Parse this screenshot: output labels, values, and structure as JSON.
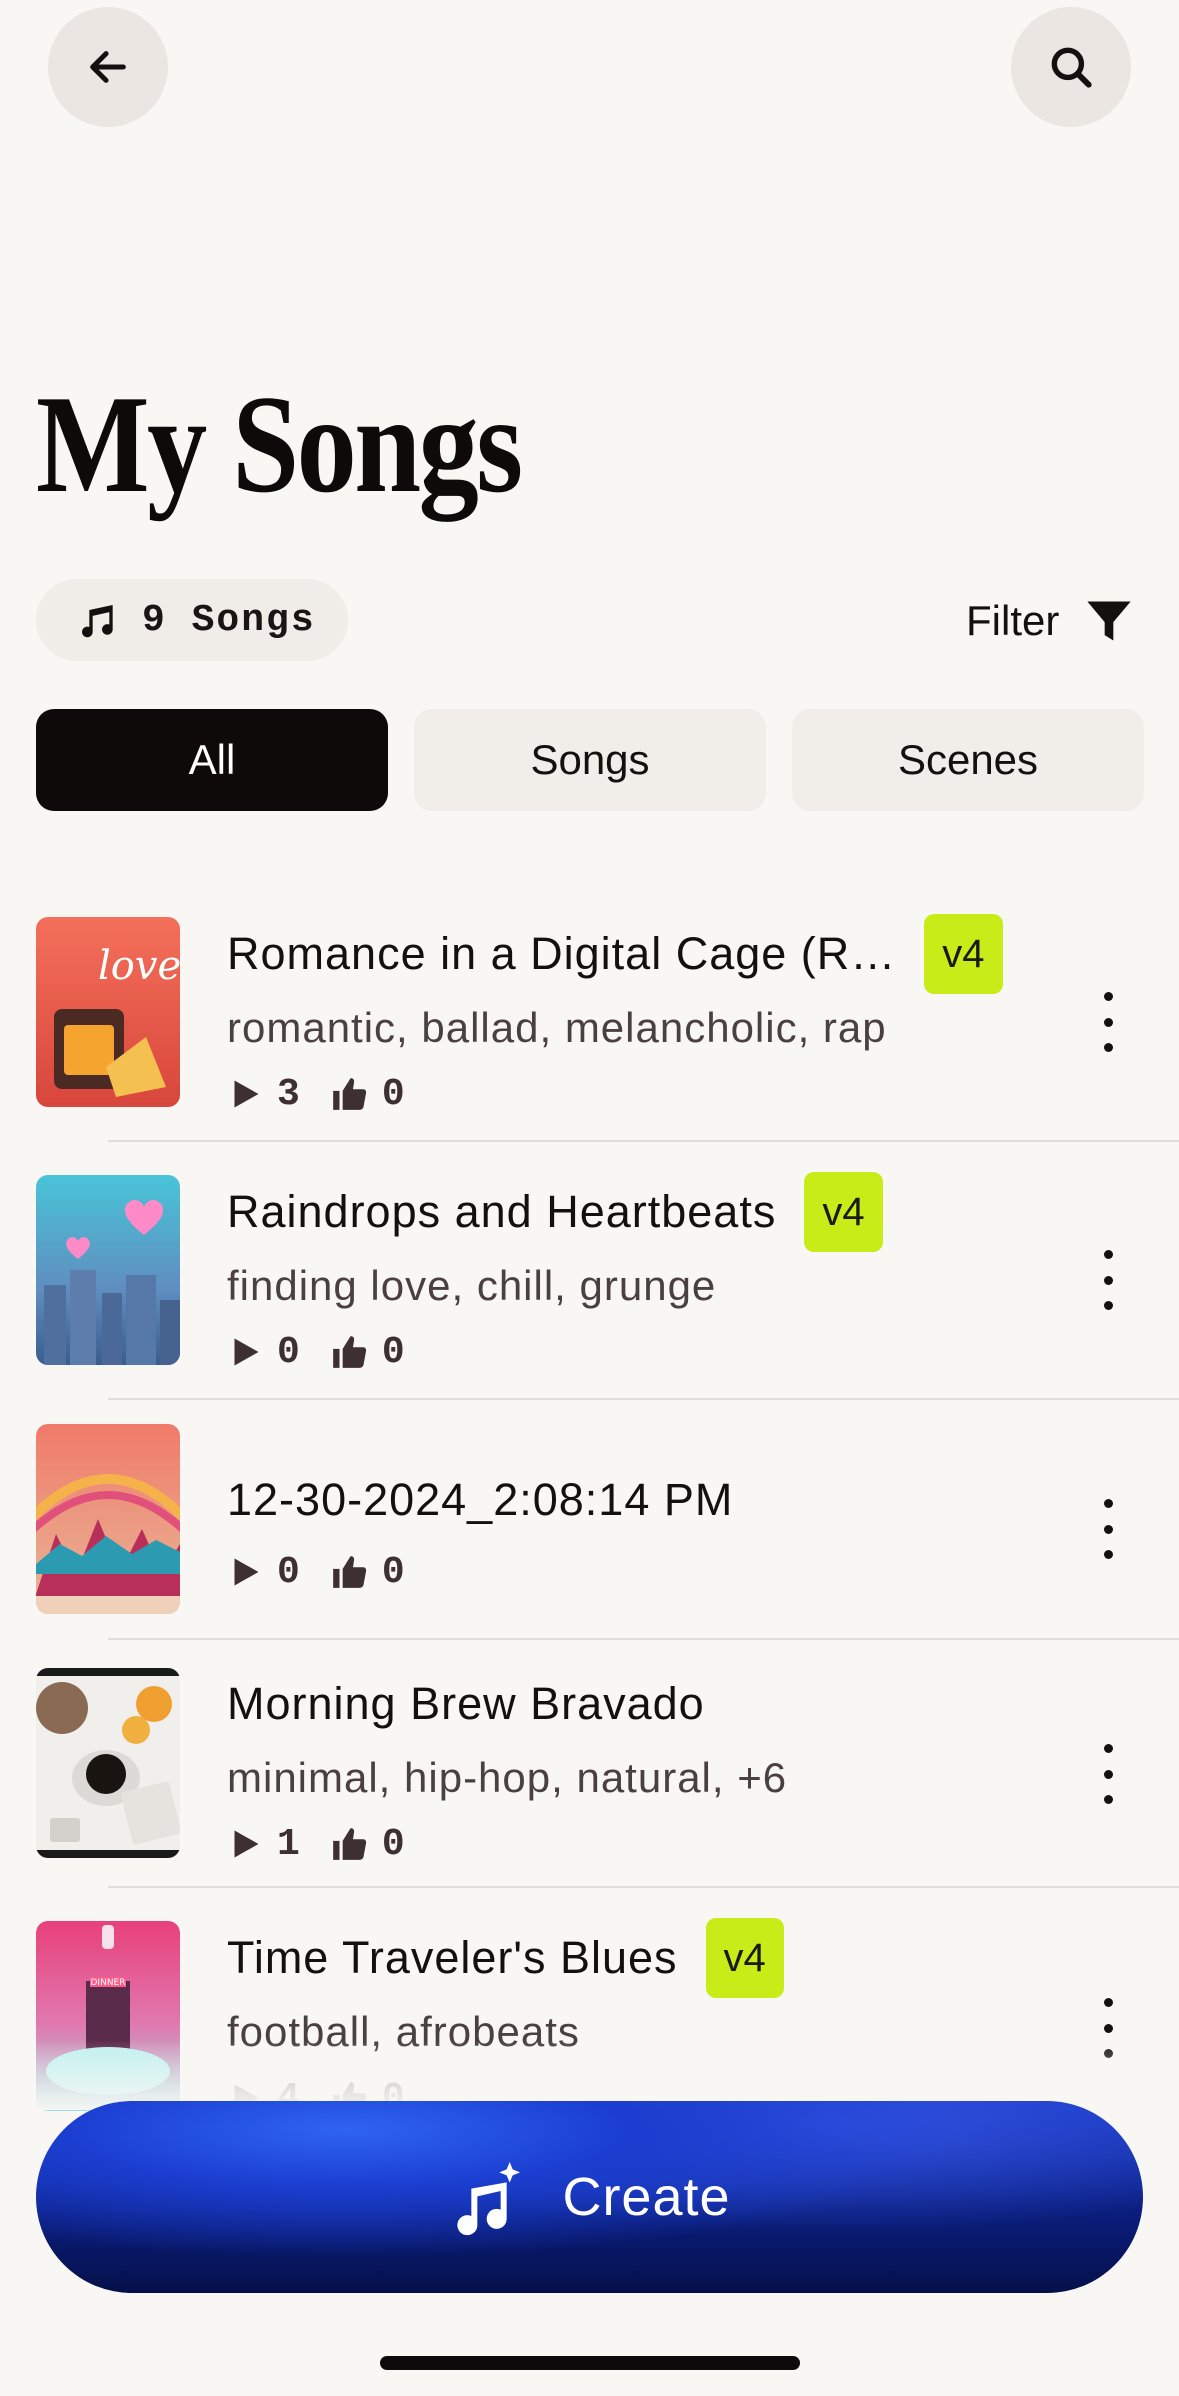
{
  "header": {
    "back_icon": "arrow-left-icon",
    "search_icon": "search-icon",
    "title": "My Songs"
  },
  "library": {
    "count_label": "9 Songs",
    "filter_label": "Filter"
  },
  "tabs": [
    {
      "label": "All",
      "active": true
    },
    {
      "label": "Songs",
      "active": false
    },
    {
      "label": "Scenes",
      "active": false
    }
  ],
  "songs": [
    {
      "title": "Romance in a Digital Cage (R…",
      "badge": "v4",
      "tags": "romantic, ballad, melancholic, rap",
      "plays": "3",
      "likes": "0"
    },
    {
      "title": "Raindrops and Heartbeats",
      "badge": "v4",
      "tags": "finding love, chill, grunge",
      "plays": "0",
      "likes": "0"
    },
    {
      "title": "12-30-2024_2:08:14 PM",
      "badge": "",
      "tags": "",
      "plays": "0",
      "likes": "0"
    },
    {
      "title": "Morning Brew Bravado",
      "badge": "",
      "tags": "minimal, hip-hop, natural, +6",
      "plays": "1",
      "likes": "0"
    },
    {
      "title": "Time Traveler's Blues",
      "badge": "v4",
      "tags": "football, afrobeats",
      "plays": "4",
      "likes": "0"
    }
  ],
  "thumb_text": {
    "love": "love",
    "sign": "DINNER"
  },
  "create": {
    "label": "Create",
    "icon": "music-sparkle-icon"
  },
  "colors": {
    "accent_badge": "#c8ec18",
    "active_tab": "#0f0a0a",
    "create_gradient_top": "#1838c4",
    "create_gradient_bottom": "#05104a"
  }
}
